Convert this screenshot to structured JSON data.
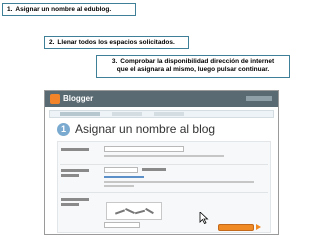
{
  "steps": [
    {
      "number": "1.",
      "text": "Asignar un nombre al edublog."
    },
    {
      "number": "2.",
      "text": "Llenar todos los espacios solicitados."
    },
    {
      "number": "3.",
      "text": "Comprobar la disponibilidad dirección de internet",
      "text2": "que el asignara al mismo, luego pulsar continuar."
    }
  ],
  "screenshot": {
    "app_name": "Blogger",
    "step_number": "1",
    "heading": "Asignar un nombre al blog",
    "url_prefix": "http://",
    "url_suffix": ".blogspot.com",
    "check_link": "Comprobar la disponibilidad"
  },
  "colors": {
    "step_border": "#3f7f98",
    "blogger_orange": "#f4842a",
    "header_bar": "#5a6a72",
    "continue_button": "#f08a24"
  }
}
